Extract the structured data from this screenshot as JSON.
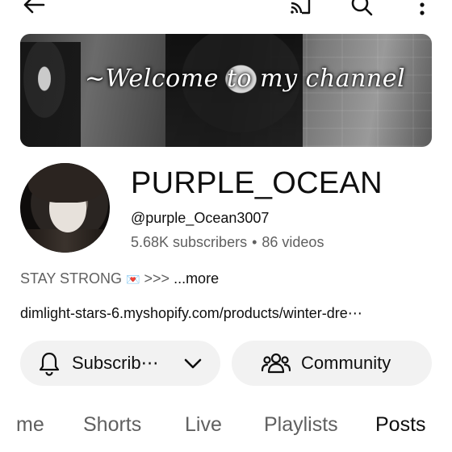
{
  "topbar": {
    "back": "back-arrow-icon",
    "cast": "cast-icon",
    "search": "search-icon",
    "more": "more-vertical-icon"
  },
  "banner": {
    "text": "~Welcome to my channel"
  },
  "channel": {
    "name": "PURPLE_OCEAN",
    "handle": "@purple_Ocean3007",
    "subscribers": "5.68K subscribers",
    "separator": "•",
    "videos": "86 videos"
  },
  "description": {
    "text": "STAY STRONG",
    "emoji": "💌",
    "suffix": ">>>",
    "more": "...more"
  },
  "link": {
    "text": "dimlight-stars-6.myshopify.com/products/winter-dre⋯"
  },
  "actions": {
    "subscribe_label": "Subscrib⋯",
    "community_label": "Community"
  },
  "tabs": [
    {
      "label": "me"
    },
    {
      "label": "Shorts"
    },
    {
      "label": "Live"
    },
    {
      "label": "Playlists"
    },
    {
      "label": "Posts"
    }
  ],
  "colors": {
    "text_primary": "#0f0f0f",
    "text_secondary": "#606060",
    "pill_bg": "#f2f2f2"
  }
}
